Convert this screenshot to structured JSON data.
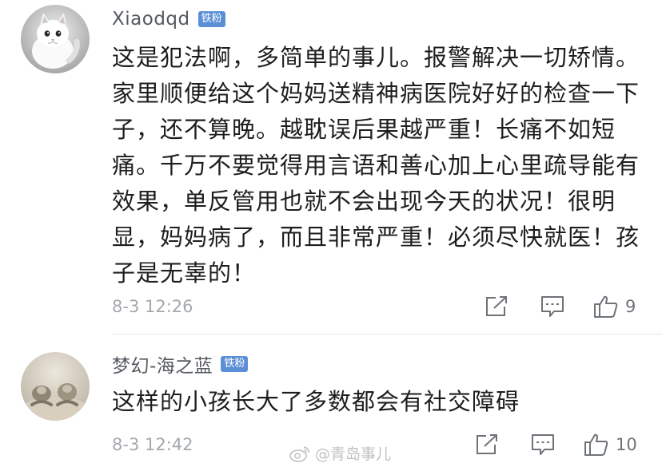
{
  "comments": [
    {
      "username": "Xiaodqd",
      "badge": "铁粉",
      "avatar": "kitten-avatar",
      "lines": [
        "这是犯法啊，多简单的事儿。报警解决一切矫情。",
        "家里顺便给这个妈妈送精神病医院好好的检查一下",
        "子，还不算晚。越耽误后果越严重！长痛不如短",
        "痛。千万不要觉得用言语和善心加上心里疏导能有",
        "效果，单反管用也就不会出现今天的状况！很明",
        "显，妈妈病了，而且非常严重！必须尽快就医！孩",
        "子是无辜的！"
      ],
      "timestamp": "8-3 12:26",
      "likes": "9"
    },
    {
      "username": "梦幻-海之蓝",
      "badge": "铁粉",
      "avatar": "pet-photo-avatar",
      "lines": [
        "这样的小孩长大了多数都会有社交障碍"
      ],
      "timestamp": "8-3 12:42",
      "likes": "10"
    }
  ],
  "watermark": "@青岛事儿",
  "colors": {
    "badge": "#5b8fd6",
    "username": "#555a60",
    "timestamp": "#a4a8ad",
    "icon": "#6e7378"
  }
}
